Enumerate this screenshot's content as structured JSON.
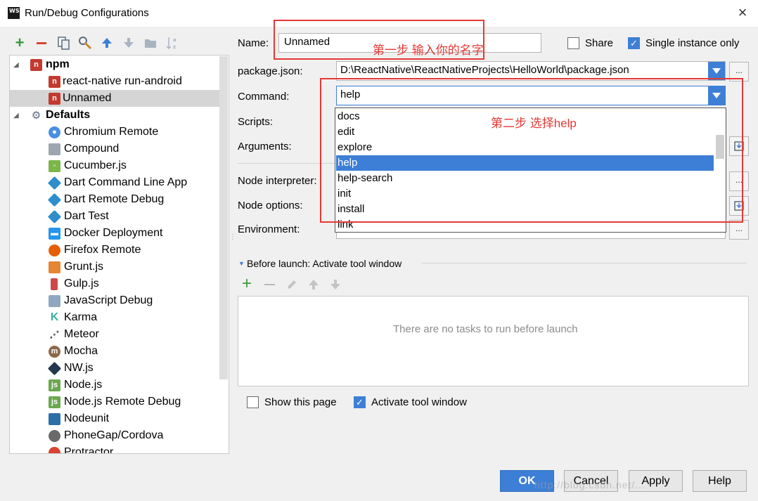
{
  "window": {
    "title": "Run/Debug Configurations",
    "app_icon_text": "WS",
    "close_glyph": "×"
  },
  "toolbar": {
    "icons": [
      "add-icon",
      "remove-icon",
      "copy-icon",
      "edit-defaults-icon",
      "move-up-icon",
      "move-down-icon",
      "folder-icon",
      "sort-icon"
    ]
  },
  "tree": {
    "items": [
      {
        "label": "npm",
        "icon": "npm-icon",
        "bold": true,
        "expanded": true
      },
      {
        "label": "react-native run-android",
        "icon": "npm-icon"
      },
      {
        "label": "Unnamed",
        "icon": "npm-icon",
        "selected": true
      },
      {
        "label": "Defaults",
        "icon": "wrench-icon",
        "bold": true,
        "expanded": true
      },
      {
        "label": "Chromium Remote",
        "icon": "chromium-icon"
      },
      {
        "label": "Compound",
        "icon": "compound-icon"
      },
      {
        "label": "Cucumber.js",
        "icon": "cucumber-icon"
      },
      {
        "label": "Dart Command Line App",
        "icon": "dart-icon"
      },
      {
        "label": "Dart Remote Debug",
        "icon": "dart-icon"
      },
      {
        "label": "Dart Test",
        "icon": "dart-icon"
      },
      {
        "label": "Docker Deployment",
        "icon": "docker-icon"
      },
      {
        "label": "Firefox Remote",
        "icon": "firefox-icon"
      },
      {
        "label": "Grunt.js",
        "icon": "grunt-icon"
      },
      {
        "label": "Gulp.js",
        "icon": "gulp-icon"
      },
      {
        "label": "JavaScript Debug",
        "icon": "javascript-debug-icon"
      },
      {
        "label": "Karma",
        "icon": "karma-icon"
      },
      {
        "label": "Meteor",
        "icon": "meteor-icon"
      },
      {
        "label": "Mocha",
        "icon": "mocha-icon"
      },
      {
        "label": "NW.js",
        "icon": "nwjs-icon"
      },
      {
        "label": "Node.js",
        "icon": "nodejs-icon"
      },
      {
        "label": "Node.js Remote Debug",
        "icon": "nodejs-debug-icon"
      },
      {
        "label": "Nodeunit",
        "icon": "nodeunit-icon"
      },
      {
        "label": "PhoneGap/Cordova",
        "icon": "phonegap-icon"
      },
      {
        "label": "Protractor",
        "icon": "protractor-icon"
      }
    ]
  },
  "form": {
    "name_label": "Name:",
    "name_value": "Unnamed",
    "share_label": "Share",
    "share_checked": false,
    "single_instance_label": "Single instance only",
    "single_instance_checked": true,
    "package_json_label": "package.json:",
    "package_json_value": "D:\\ReactNative\\ReactNativeProjects\\HelloWorld\\package.json",
    "command_label": "Command:",
    "command_value": "help",
    "scripts_label": "Scripts:",
    "arguments_label": "Arguments:",
    "node_interpreter_label": "Node interpreter:",
    "node_options_label": "Node options:",
    "environment_label": "Environment:",
    "ellipsis": "..."
  },
  "command_dropdown": {
    "options": [
      "docs",
      "edit",
      "explore",
      "help",
      "help-search",
      "init",
      "install",
      "link"
    ],
    "selected": "help"
  },
  "annotations": {
    "step1": "第一步 输入你的名字",
    "step2": "第二步 选择help",
    "color": "#e53935"
  },
  "before_launch": {
    "title": "Before launch: Activate tool window",
    "empty_text": "There are no tasks to run before launch",
    "toolbar_icons": [
      "add-icon",
      "remove-icon",
      "edit-icon",
      "move-up-icon",
      "move-down-icon"
    ]
  },
  "options": {
    "show_page_label": "Show this page",
    "show_page_checked": false,
    "activate_tool_window_label": "Activate tool window",
    "activate_tool_window_checked": true
  },
  "buttons": {
    "ok": "OK",
    "cancel": "Cancel",
    "apply": "Apply",
    "help": "Help"
  },
  "watermark": "http://blog.csdn.net/..."
}
